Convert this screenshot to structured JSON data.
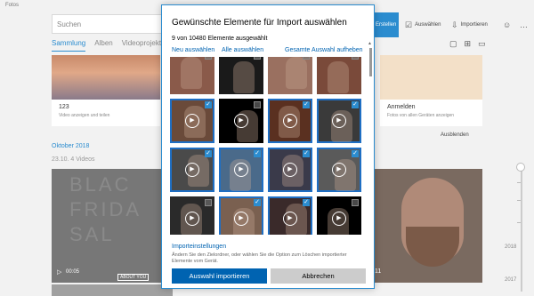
{
  "app": {
    "title": "Fotos",
    "search_placeholder": "Suchen",
    "create_label": "Erstellen",
    "select_label": "Auswählen",
    "import_label": "Importieren",
    "tabs": [
      {
        "label": "Sammlung",
        "active": true
      },
      {
        "label": "Alben",
        "active": false
      },
      {
        "label": "Videoprojekte",
        "active": false
      }
    ],
    "card_left": {
      "title": "123",
      "subtitle": "Video anzeigen und teilen"
    },
    "card_right": {
      "title": "Anmelden",
      "subtitle": "Fotos von allen Geräten anzeigen"
    },
    "dismiss_label": "Ausblenden",
    "section_title": "Oktober 2018",
    "section_subtitle": "23.10.   4 Videos",
    "video_bg_text": "BLAC\nFRIDA\nSAL",
    "video_duration": "00:05",
    "video_tag": "ABOUT YOU",
    "video_right_number": "11",
    "timeline_years": [
      "2018",
      "2017"
    ],
    "accent_color": "#2b8ccf"
  },
  "dialog": {
    "title": "Gewünschte Elemente für Import auswählen",
    "count_text": "9 von 10480 Elemente ausgewählt",
    "link_new": "Neu auswählen",
    "link_all": "Alle auswählen",
    "link_clear": "Gesamte Auswahl aufheben",
    "settings_link": "Importeinstellungen",
    "settings_desc": "Ändern Sie den Zielordner, oder wählen Sie die Option zum Löschen importierter Elemente vom Gerät.",
    "primary_button": "Auswahl importieren",
    "secondary_button": "Abbrechen",
    "check_glyph": "✓",
    "play_glyph": "▶",
    "thumbnails": [
      {
        "selected": false,
        "color": "#8a5a4a",
        "video": false
      },
      {
        "selected": false,
        "color": "#1a1a1a",
        "video": false
      },
      {
        "selected": false,
        "color": "#9a7060",
        "video": false
      },
      {
        "selected": false,
        "color": "#7a4a3a",
        "video": false
      },
      {
        "selected": true,
        "color": "#6a4a3a",
        "video": true
      },
      {
        "selected": false,
        "color": "#000000",
        "video": true
      },
      {
        "selected": true,
        "color": "#5a3020",
        "video": true
      },
      {
        "selected": true,
        "color": "#3a3a3a",
        "video": true
      },
      {
        "selected": true,
        "color": "#4a4a4a",
        "video": true
      },
      {
        "selected": true,
        "color": "#4a6a8a",
        "video": true
      },
      {
        "selected": true,
        "color": "#3a3a4a",
        "video": true
      },
      {
        "selected": true,
        "color": "#5a5a5a",
        "video": true
      },
      {
        "selected": false,
        "color": "#2a2a2a",
        "video": true
      },
      {
        "selected": true,
        "color": "#7a6050",
        "video": true
      },
      {
        "selected": true,
        "color": "#3a2a2a",
        "video": true
      },
      {
        "selected": false,
        "color": "#000000",
        "video": true
      },
      {
        "selected": false,
        "color": "#3a3a3a",
        "video": false
      },
      {
        "selected": false,
        "color": "#6a5040",
        "video": false
      },
      {
        "selected": false,
        "color": "#4a3a30",
        "video": false
      },
      {
        "selected": false,
        "color": "#2a2a2a",
        "video": false
      }
    ]
  }
}
